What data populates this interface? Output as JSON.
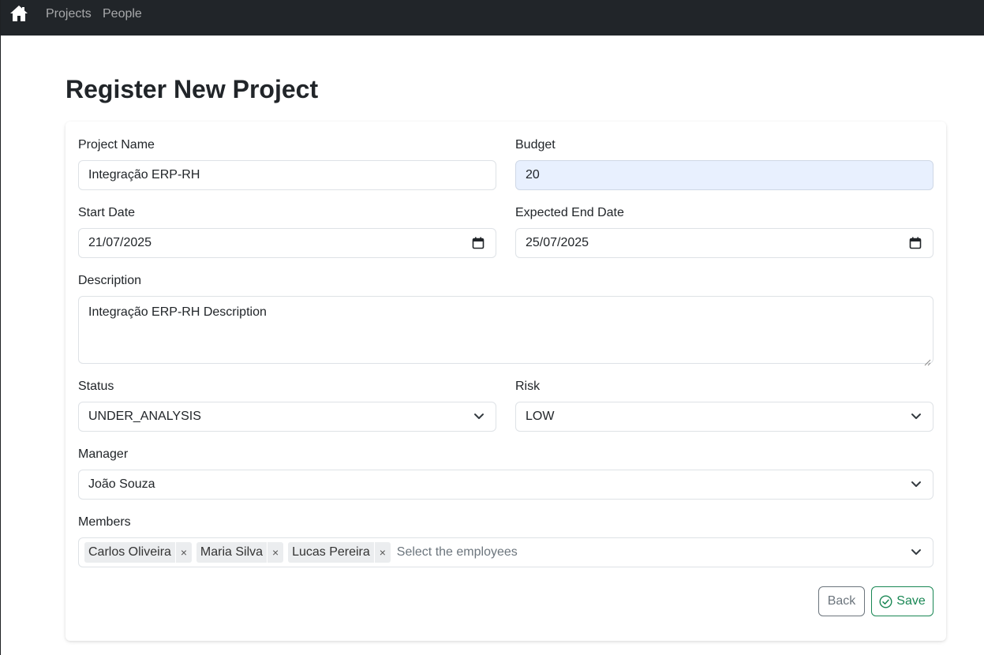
{
  "nav": {
    "home_icon": "home-icon",
    "links": [
      "Projects",
      "People"
    ]
  },
  "page": {
    "title": "Register New Project"
  },
  "form": {
    "project_name": {
      "label": "Project Name",
      "value": "Integração ERP-RH"
    },
    "budget": {
      "label": "Budget",
      "value": "20"
    },
    "start_date": {
      "label": "Start Date",
      "value": "21/07/2025",
      "icon": "calendar-icon"
    },
    "end_date": {
      "label": "Expected End Date",
      "value": "25/07/2025",
      "icon": "calendar-icon"
    },
    "description": {
      "label": "Description",
      "value": "Integração ERP-RH Description"
    },
    "status": {
      "label": "Status",
      "value": "UNDER_ANALYSIS"
    },
    "risk": {
      "label": "Risk",
      "value": "LOW"
    },
    "manager": {
      "label": "Manager",
      "value": "João Souza"
    },
    "members": {
      "label": "Members",
      "selected": [
        "Carlos Oliveira",
        "Maria Silva",
        "Lucas Pereira"
      ],
      "remove_symbol": "×",
      "placeholder": "Select the employees"
    }
  },
  "actions": {
    "back_label": "Back",
    "save_label": "Save",
    "save_icon": "check-circle-icon"
  },
  "colors": {
    "navbar": "#212529",
    "autofill": "#e8f0fe",
    "save": "#198754",
    "back": "#6c757d"
  }
}
